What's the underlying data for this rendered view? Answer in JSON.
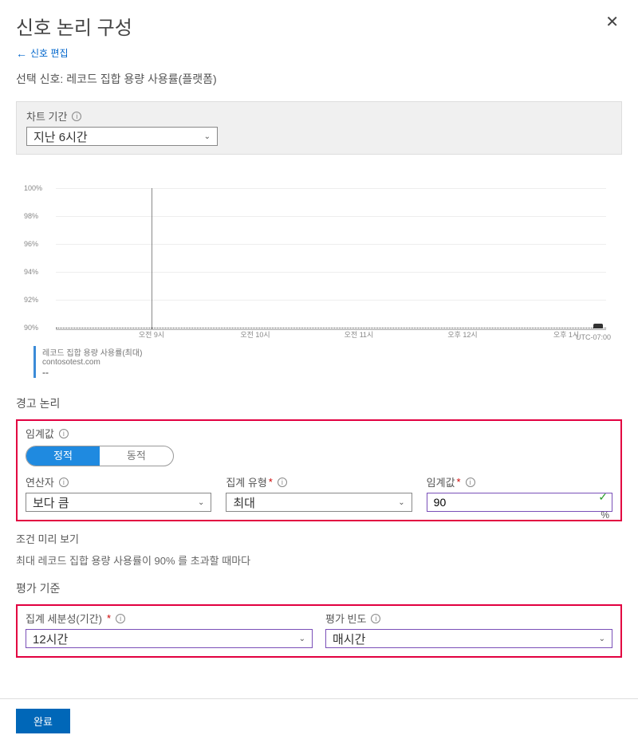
{
  "header": {
    "title": "신호 논리 구성",
    "back_link": "신호 편집"
  },
  "selected_signal_label": "선택 신호: 레코드 집합 용량 사용률(플랫폼)",
  "chart_period": {
    "label": "차트 기간",
    "value": "지난 6시간"
  },
  "chart_data": {
    "type": "line",
    "y_ticks": [
      "100%",
      "98%",
      "96%",
      "94%",
      "92%",
      "90%"
    ],
    "x_ticks": [
      "오전 9시",
      "오전 10시",
      "오전 11시",
      "오후 12시",
      "오후 1시"
    ],
    "timezone": "UTC-07:00",
    "threshold": 90,
    "ylim": [
      90,
      100
    ]
  },
  "legend": {
    "line1": "레코드 집합 용량 사용률(최대)",
    "line2": "contosotest.com",
    "value": "--"
  },
  "alert_logic": {
    "section_label": "경고 논리",
    "threshold_label": "임계값",
    "toggle": {
      "static": "정적",
      "dynamic": "동적"
    },
    "operator": {
      "label": "연산자",
      "value": "보다 큼"
    },
    "aggregation": {
      "label": "집계 유형",
      "value": "최대"
    },
    "threshold_value": {
      "label": "임계값",
      "value": "90",
      "unit": "%"
    }
  },
  "preview": {
    "label": "조건 미리 보기",
    "text": "최대 레코드 집합 용량 사용률이 90% 를 초과할 때마다"
  },
  "evaluation": {
    "section_label": "평가 기준",
    "granularity": {
      "label": "집계 세분성(기간)",
      "value": "12시간"
    },
    "frequency": {
      "label": "평가 빈도",
      "value": "매시간"
    }
  },
  "footer": {
    "done": "완료"
  }
}
